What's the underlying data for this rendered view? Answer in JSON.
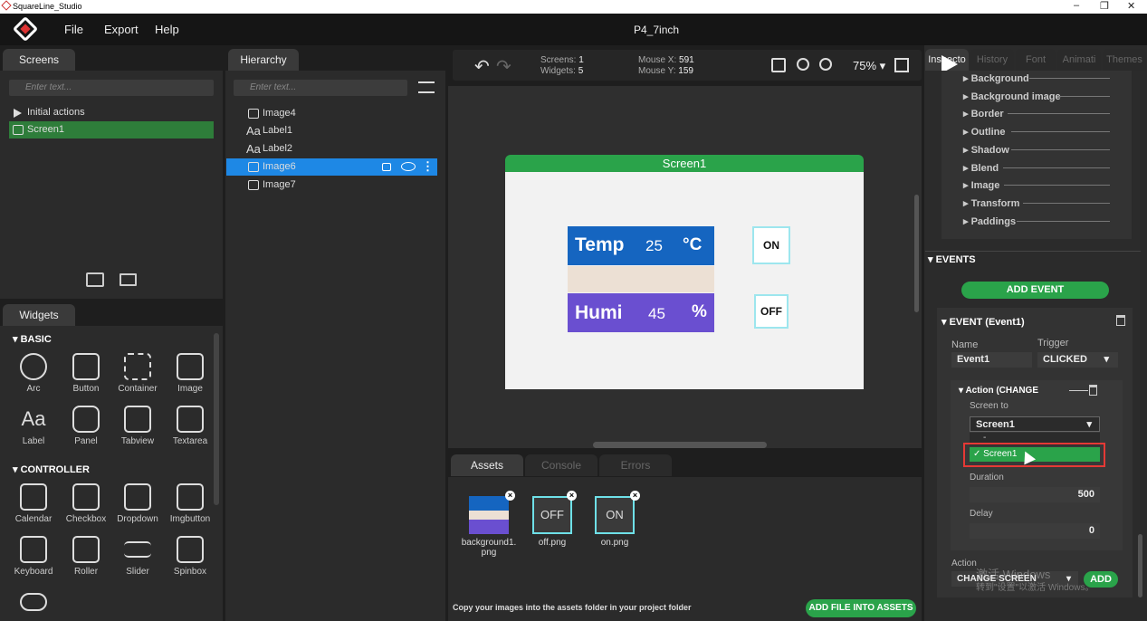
{
  "app": {
    "title": "SquareLine_Studio",
    "window_controls": [
      "–",
      "❐",
      "✕"
    ],
    "menu": [
      "File",
      "Export",
      "Help"
    ],
    "project": "P4_7inch"
  },
  "screens_panel": {
    "tab": "Screens",
    "search_placeholder": "Enter text...",
    "items": [
      "Initial actions",
      "Screen1"
    ]
  },
  "hierarchy": {
    "tab": "Hierarchy",
    "search_placeholder": "Enter text...",
    "items": [
      "Image4",
      "Label1",
      "Label2",
      "Image6",
      "Image7"
    ],
    "selected": "Image6"
  },
  "widgets": {
    "tab": "Widgets",
    "basic_title": "BASIC",
    "basic": [
      "Arc",
      "Button",
      "Container",
      "Image",
      "Label",
      "Panel",
      "Tabview",
      "Textarea"
    ],
    "controller_title": "CONTROLLER",
    "controller": [
      "Calendar",
      "Checkbox",
      "Dropdown",
      "Imgbutton",
      "Keyboard",
      "Roller",
      "Slider",
      "Spinbox"
    ]
  },
  "toolbar": {
    "screens_label": "Screens:",
    "screens": "1",
    "widgets_label": "Widgets:",
    "widgets": "5",
    "mousex_label": "Mouse X:",
    "mousex": "591",
    "mousey_label": "Mouse Y:",
    "mousey": "159",
    "zoom": "75%"
  },
  "canvas": {
    "screen_name": "Screen1",
    "temp_label": "Temp",
    "temp_value": "25",
    "temp_unit": "°C",
    "humi_label": "Humi",
    "humi_value": "45",
    "humi_unit": "%",
    "on": "ON",
    "off": "OFF"
  },
  "bottom": {
    "tabs": [
      "Assets",
      "Console",
      "Errors"
    ],
    "assets": [
      {
        "name": "background1.\npng",
        "thumb": ""
      },
      {
        "name": "off.png",
        "thumb": "OFF"
      },
      {
        "name": "on.png",
        "thumb": "ON"
      }
    ],
    "hint": "Copy your images into the assets folder in your project folder",
    "add_button": "ADD FILE INTO ASSETS"
  },
  "inspector": {
    "tabs": [
      "Inspecto",
      "History",
      "Font",
      "Animati",
      "Themes"
    ],
    "props": [
      "Background",
      "Background image",
      "Border",
      "Outline",
      "Shadow",
      "Blend",
      "Image",
      "Transform",
      "Paddings"
    ],
    "events_title": "EVENTS",
    "add_event": "ADD EVENT",
    "event_title": "EVENT (Event1)",
    "name_label": "Name",
    "name": "Event1",
    "trigger_label": "Trigger",
    "trigger": "CLICKED",
    "action_title": "Action (CHANGE",
    "screen_to_label": "Screen to",
    "screen_to": "Screen1",
    "dropdown_option": "Screen1",
    "dropdown_dash": "-",
    "duration_label": "Duration",
    "duration": "500",
    "delay_label": "Delay",
    "delay": "0",
    "action_label": "Action",
    "action_value": "CHANGE SCREEN",
    "add": "ADD",
    "watermark1": "激活 Windows",
    "watermark2": "转到\"设置\"以激活 Windows。"
  },
  "colors": {
    "accent": "#2aa34a",
    "selected": "#1e88e5",
    "highlight_border": "#e53935"
  }
}
